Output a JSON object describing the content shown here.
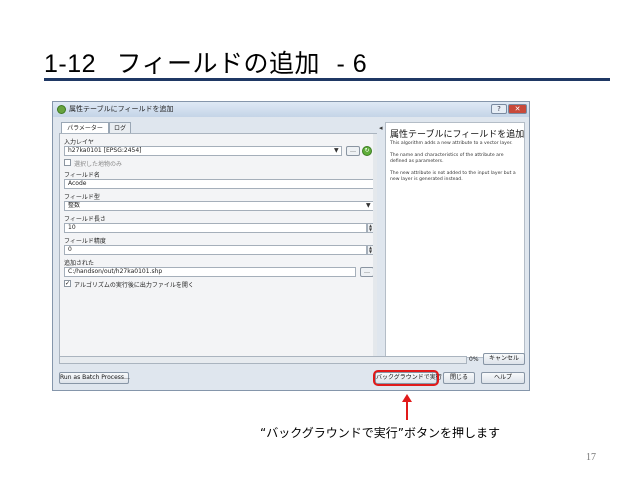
{
  "slide": {
    "title_number": "1-12",
    "title_text": "フィールドの追加",
    "title_suffix": "- 6",
    "page_number": "17",
    "caption": "“バックグラウンドで実行”ボタンを押します",
    "accent_color": "#1f3864",
    "highlight_color": "#e11a1a"
  },
  "window": {
    "title": "属性テーブルにフィールドを追加",
    "help_button": "?",
    "close_button": "✕",
    "tabs": [
      {
        "label": "パラメーター"
      },
      {
        "label": "ログ"
      }
    ]
  },
  "form": {
    "input_layer_label": "入力レイヤ",
    "input_layer_value": "h27ka0101 [EPSG:2454]",
    "selected_only_label": "選択した地物のみ",
    "field_name_label": "フィールド名",
    "field_name_value": "Acode",
    "field_type_label": "フィールド型",
    "field_type_value": "整数",
    "field_length_label": "フィールド長さ",
    "field_length_value": "10",
    "field_precision_label": "フィールド精度",
    "field_precision_value": "0",
    "added_output_label": "追加された",
    "added_output_value": "C:/handson/out/h27ka0101.shp",
    "open_output_label": "アルゴリズムの実行後に出力ファイルを開く",
    "browse_button": "…",
    "open_output_checked": "✓"
  },
  "help": {
    "title": "属性テーブルにフィールドを追加",
    "paragraphs": [
      "This algorithm adds a new attribute to a vector layer.",
      "The name and characteristics of the attribute are defined as parameters.",
      "The new attribute is not added to the input layer but a new layer is generated instead."
    ]
  },
  "footer": {
    "progress_value": 0,
    "progress_text": "0%",
    "cancel_button": "キャンセル",
    "batch_button": "Run as Batch Process…",
    "run_background_button": "バックグラウンドで実行",
    "close_button": "閉じる",
    "help_button": "ヘルプ"
  },
  "icons": {
    "app": "qgis-icon",
    "refresh": "refresh-icon",
    "dropdown": "chevron-down-icon",
    "collapse": "chevron-left-icon",
    "arrow": "red-up-arrow-icon"
  }
}
